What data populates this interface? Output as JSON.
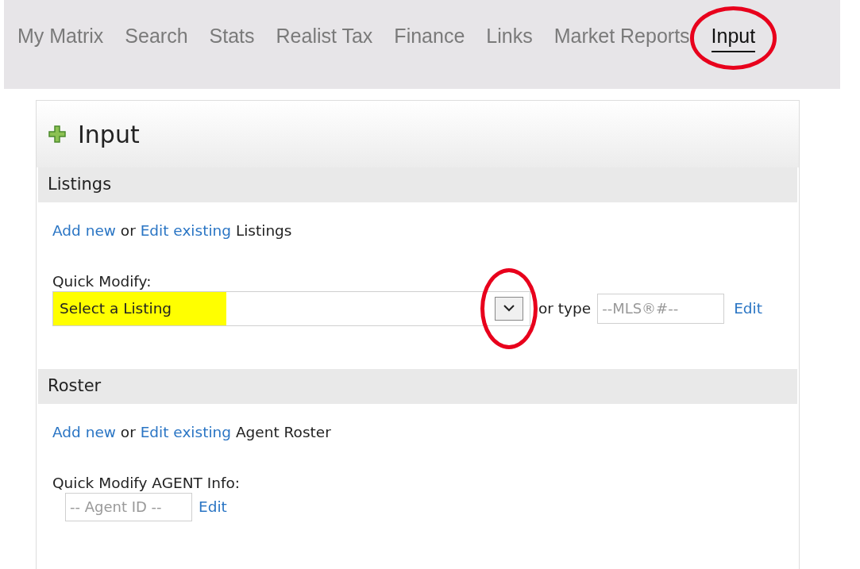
{
  "nav": {
    "tabs": [
      {
        "label": "My Matrix",
        "selected": false,
        "circled": false
      },
      {
        "label": "Search",
        "selected": false,
        "circled": false
      },
      {
        "label": "Stats",
        "selected": false,
        "circled": false
      },
      {
        "label": "Realist Tax",
        "selected": false,
        "circled": false
      },
      {
        "label": "Finance",
        "selected": false,
        "circled": false
      },
      {
        "label": "Links",
        "selected": false,
        "circled": false
      },
      {
        "label": "Market Reports",
        "selected": false,
        "circled": false
      },
      {
        "label": "Input",
        "selected": true,
        "circled": true
      }
    ]
  },
  "panel": {
    "title": "Input",
    "listings": {
      "title": "Listings",
      "sentence": [
        {
          "kind": "link",
          "text": "Add new"
        },
        {
          "kind": "text",
          "text": "or"
        },
        {
          "kind": "link",
          "text": "Edit existing"
        },
        {
          "kind": "text",
          "text": "Listings"
        }
      ],
      "quick_label": "Quick Modify:",
      "select": {
        "value": "Select a Listing",
        "highlighted": true,
        "button_circled": true
      },
      "or_text": "or type",
      "mls_field": {
        "placeholder": "--MLS®#--"
      },
      "edit_link": "Edit"
    },
    "roster": {
      "title": "Roster",
      "sentence": [
        {
          "kind": "link",
          "text": "Add new"
        },
        {
          "kind": "text",
          "text": "or"
        },
        {
          "kind": "link",
          "text": "Edit existing"
        },
        {
          "kind": "text",
          "text": "Agent Roster"
        }
      ],
      "quick_label": "Quick Modify AGENT Info:",
      "agent_field": {
        "placeholder": "-- Agent ID --"
      },
      "edit_link": "Edit"
    }
  }
}
